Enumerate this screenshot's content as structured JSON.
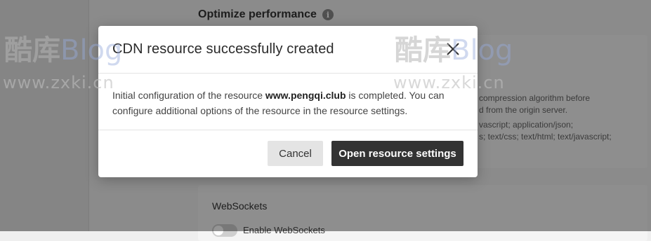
{
  "page": {
    "section_title": "Optimize performance",
    "info_icon": "i"
  },
  "compression_card": {
    "line1": "compression algorithm before",
    "line2": "d from the origin server.",
    "line3": "vascript; application/json;",
    "line4": "s; text/css; text/html; text/javascript;"
  },
  "websockets_card": {
    "title": "WebSockets",
    "toggle_label": "Enable WebSockets"
  },
  "modal": {
    "title": "CDN resource successfully created",
    "body_prefix": "Initial configuration of the resource ",
    "resource_name": "www.pengqi.club",
    "body_suffix": " is completed. You can configure additional options of the resource in the resource settings.",
    "cancel_label": "Cancel",
    "open_settings_label": "Open resource settings",
    "close_icon": "close-icon"
  },
  "watermark": {
    "cn_text": "酷库",
    "en_text": "Blog",
    "url_text": "www.zxki.cn"
  },
  "colors": {
    "primary_button": "#333333",
    "secondary_button": "#e4e4e4",
    "overlay": "rgba(0,0,0,0.42)"
  }
}
